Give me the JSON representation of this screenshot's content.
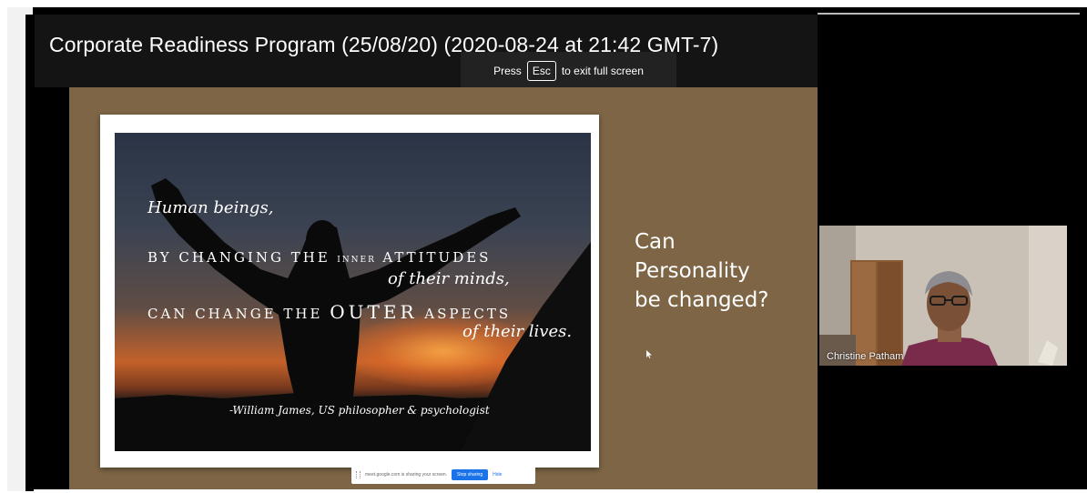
{
  "meeting": {
    "title": "Corporate Readiness Program (25/08/20) (2020-08-24 at 21:42 GMT-7)"
  },
  "fullscreen_hint": {
    "prefix": "Press",
    "key": "Esc",
    "suffix": "to exit full screen"
  },
  "slide": {
    "background_color": "#7d6545",
    "quote": {
      "line1": "Human beings,",
      "line2_a": "BY CHANGING THE",
      "line2_b": "INNER",
      "line2_c": "ATTITUDES",
      "line3": "of their minds,",
      "line4_a": "CAN CHANGE THE",
      "line4_b": "OUTER",
      "line4_c": "ASPECTS",
      "line5": "of their lives.",
      "author": "-William James, US philosopher & psychologist"
    },
    "question": {
      "part1": "Can",
      "part2": "Personality",
      "part3": "be changed?"
    }
  },
  "share_bar": {
    "message": "meet.google.com is sharing your screen.",
    "stop_label": "Stop sharing",
    "hide_label": "Hide"
  },
  "participant": {
    "name": "Christine Patham"
  },
  "colors": {
    "accent_blue": "#1a73e8",
    "frame_black": "#000000"
  },
  "icons": [
    "mouse-cursor-icon",
    "drag-handle-icon"
  ]
}
